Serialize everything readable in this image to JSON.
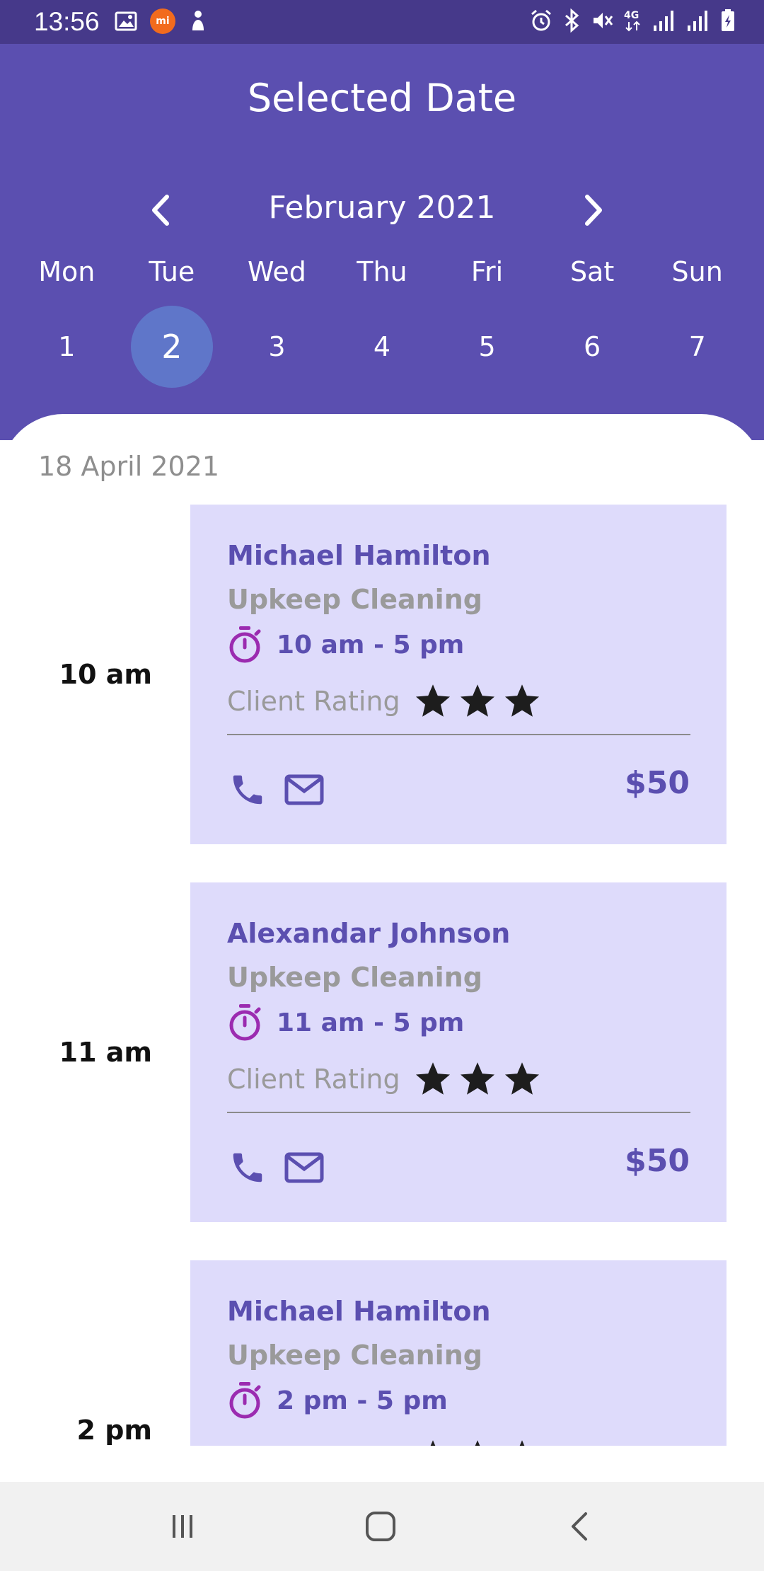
{
  "status_bar": {
    "time": "13:56",
    "left_icons": [
      "gallery-icon",
      "mi-icon",
      "notification-figure-icon"
    ],
    "right_icons": [
      "alarm-icon",
      "bluetooth-icon",
      "mute-icon",
      "4g-icon",
      "signal-icon",
      "signal-icon",
      "battery-charging-icon"
    ],
    "mi_label": "mi"
  },
  "header": {
    "title": "Selected Date",
    "month_label": "February 2021",
    "background": "#5b4fb0"
  },
  "week": {
    "days": [
      {
        "weekday": "Mon",
        "date": "1",
        "selected": false
      },
      {
        "weekday": "Tue",
        "date": "2",
        "selected": true
      },
      {
        "weekday": "Wed",
        "date": "3",
        "selected": false
      },
      {
        "weekday": "Thu",
        "date": "4",
        "selected": false
      },
      {
        "weekday": "Fri",
        "date": "5",
        "selected": false
      },
      {
        "weekday": "Sat",
        "date": "6",
        "selected": false
      },
      {
        "weekday": "Sun",
        "date": "7",
        "selected": false
      }
    ]
  },
  "schedule": {
    "date_heading": "18 April 2021",
    "rating_label": "Client Rating",
    "appointments": [
      {
        "time": "10 am",
        "client": "Michael Hamilton",
        "service": "Upkeep Cleaning",
        "hours": "10 am - 5 pm",
        "rating": 3,
        "price": "$50"
      },
      {
        "time": "11 am",
        "client": "Alexandar Johnson",
        "service": "Upkeep Cleaning",
        "hours": "11 am - 5 pm",
        "rating": 3,
        "price": "$50"
      },
      {
        "time": "2 pm",
        "client": "Michael Hamilton",
        "service": "Upkeep Cleaning",
        "hours": "2 pm - 5 pm",
        "rating": 3,
        "price": ""
      }
    ]
  },
  "colors": {
    "primary": "#5b4fb0",
    "card": "#dedbfb",
    "timer_icon": "#9b2bb0",
    "selected_day": "#5f76c9"
  }
}
